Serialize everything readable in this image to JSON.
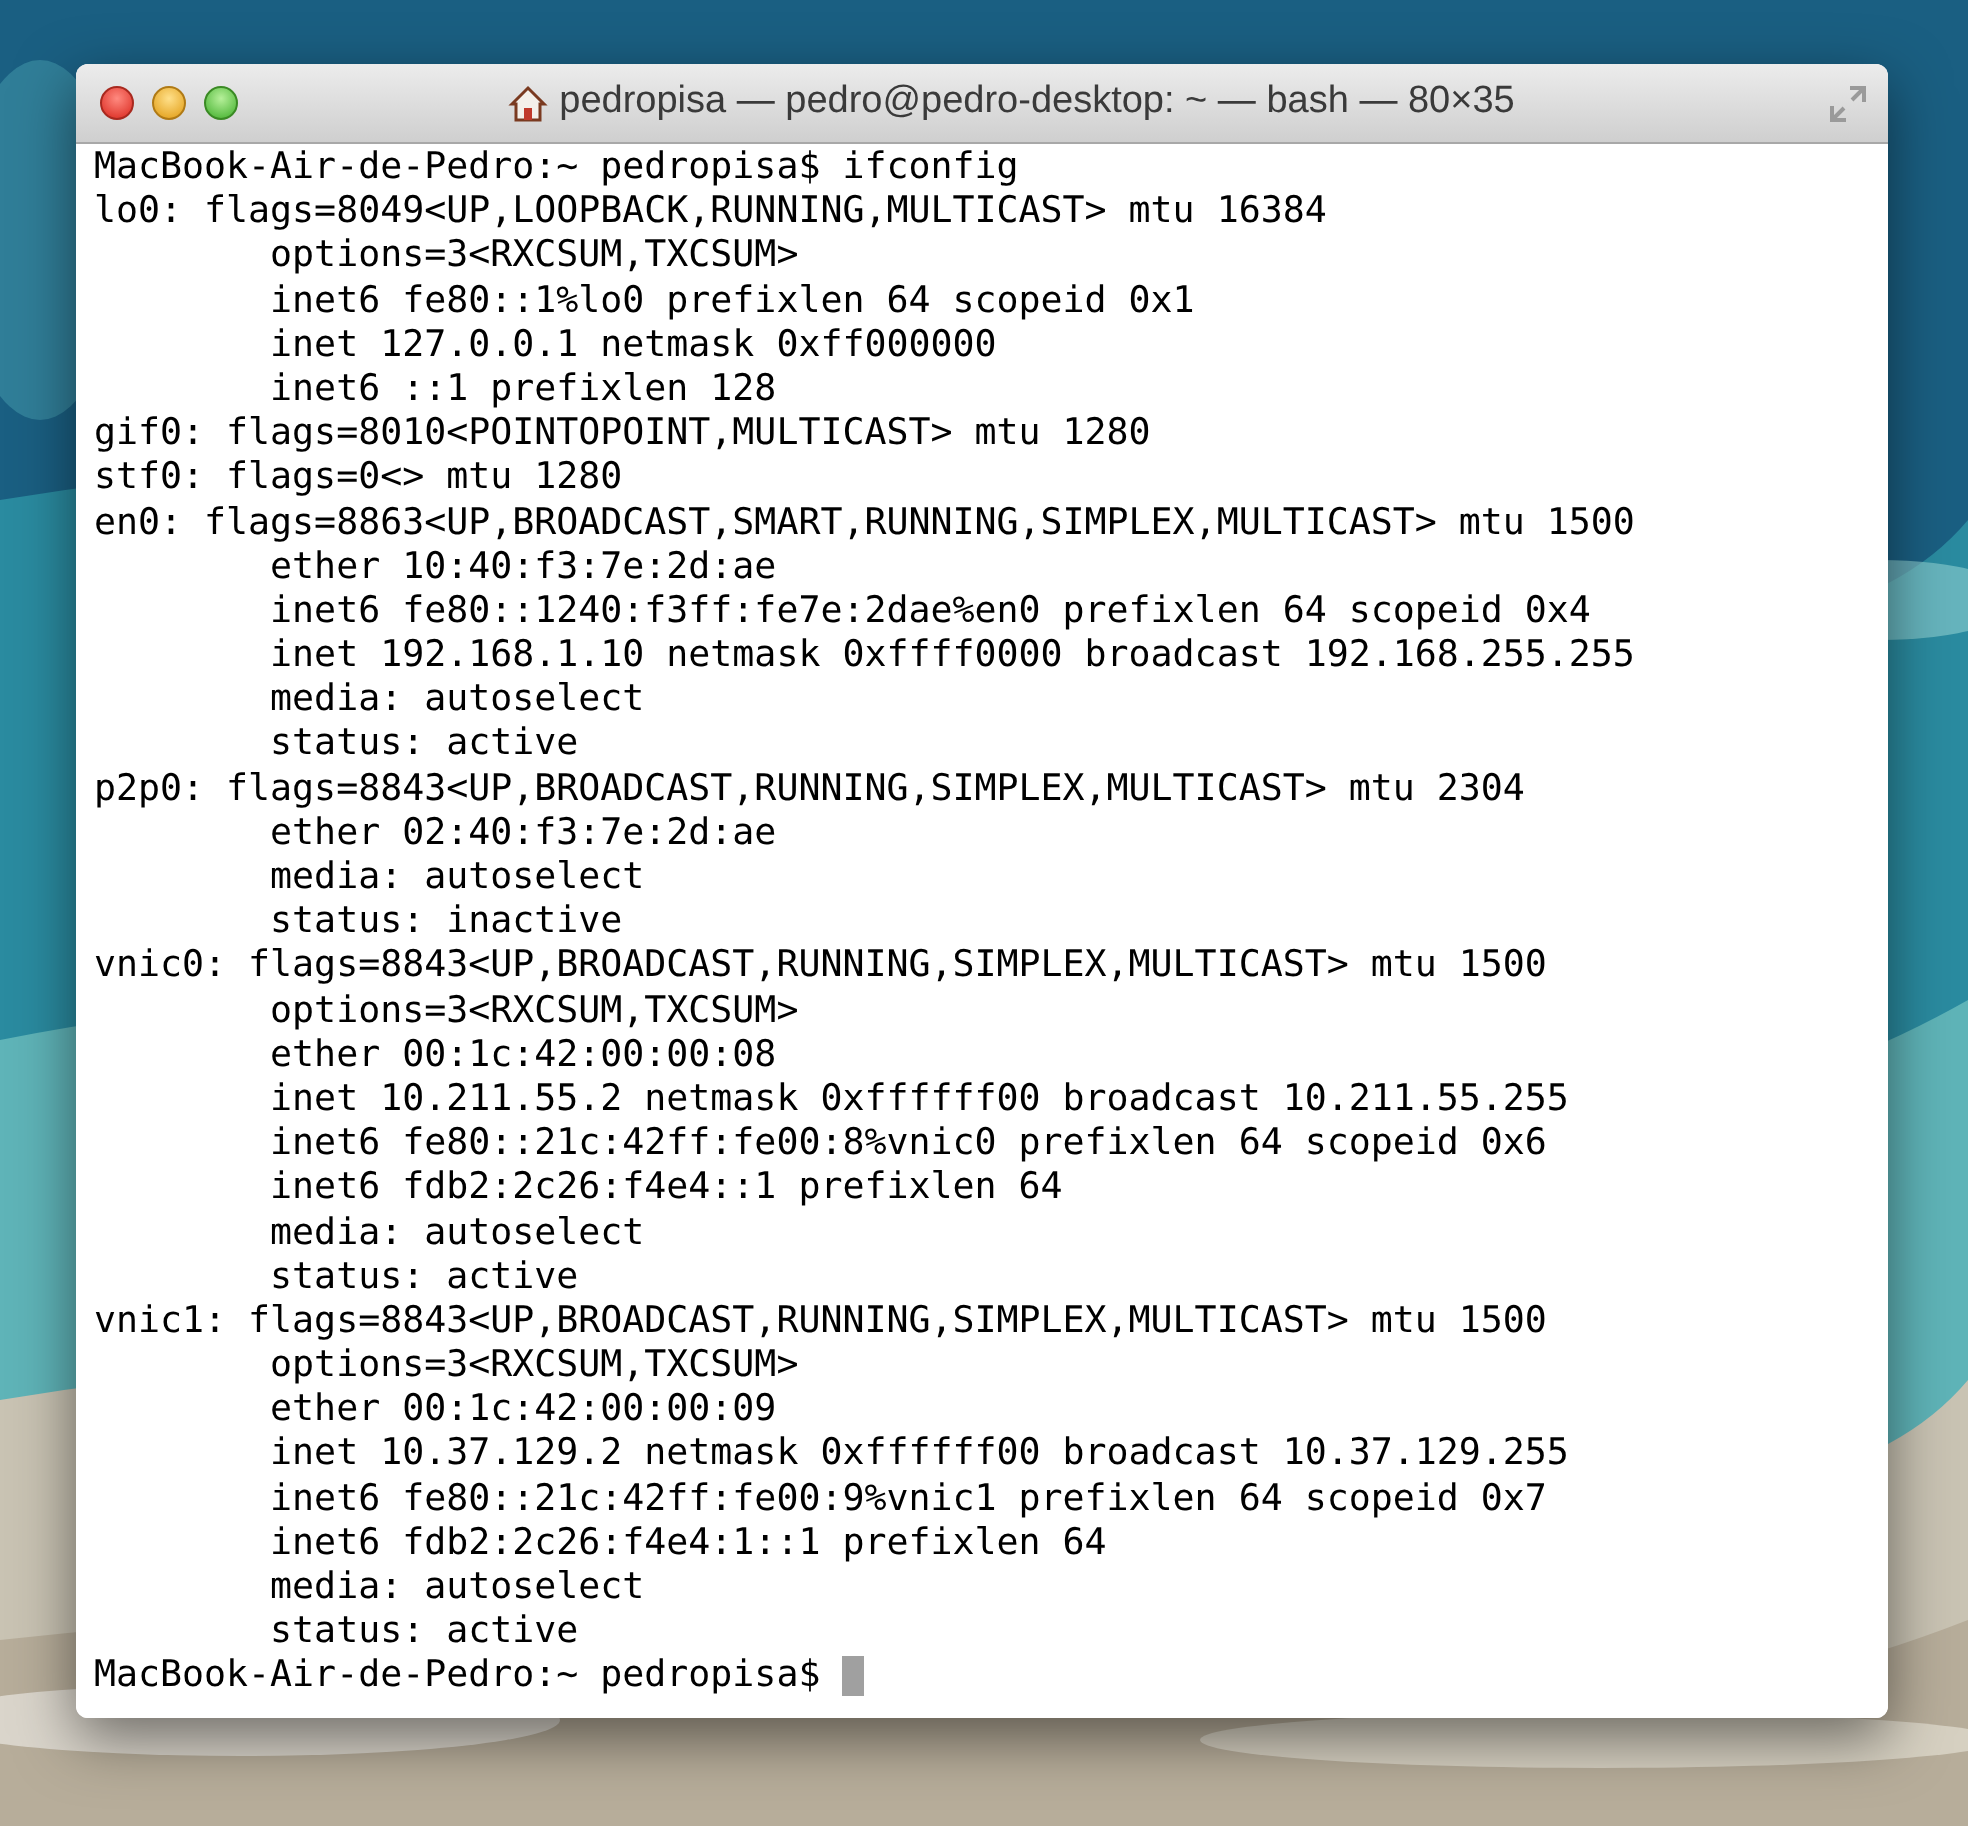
{
  "window": {
    "title": "pedropisa — pedro@pedro-desktop: ~ — bash — 80×35"
  },
  "terminal": {
    "cursor": true,
    "lines": [
      "MacBook-Air-de-Pedro:~ pedropisa$ ifconfig",
      "lo0: flags=8049<UP,LOOPBACK,RUNNING,MULTICAST> mtu 16384",
      "        options=3<RXCSUM,TXCSUM>",
      "        inet6 fe80::1%lo0 prefixlen 64 scopeid 0x1",
      "        inet 127.0.0.1 netmask 0xff000000",
      "        inet6 ::1 prefixlen 128",
      "gif0: flags=8010<POINTOPOINT,MULTICAST> mtu 1280",
      "stf0: flags=0<> mtu 1280",
      "en0: flags=8863<UP,BROADCAST,SMART,RUNNING,SIMPLEX,MULTICAST> mtu 1500",
      "        ether 10:40:f3:7e:2d:ae",
      "        inet6 fe80::1240:f3ff:fe7e:2dae%en0 prefixlen 64 scopeid 0x4",
      "        inet 192.168.1.10 netmask 0xffff0000 broadcast 192.168.255.255",
      "        media: autoselect",
      "        status: active",
      "p2p0: flags=8843<UP,BROADCAST,RUNNING,SIMPLEX,MULTICAST> mtu 2304",
      "        ether 02:40:f3:7e:2d:ae",
      "        media: autoselect",
      "        status: inactive",
      "vnic0: flags=8843<UP,BROADCAST,RUNNING,SIMPLEX,MULTICAST> mtu 1500",
      "        options=3<RXCSUM,TXCSUM>",
      "        ether 00:1c:42:00:00:08",
      "        inet 10.211.55.2 netmask 0xffffff00 broadcast 10.211.55.255",
      "        inet6 fe80::21c:42ff:fe00:8%vnic0 prefixlen 64 scopeid 0x6",
      "        inet6 fdb2:2c26:f4e4::1 prefixlen 64",
      "        media: autoselect",
      "        status: active",
      "vnic1: flags=8843<UP,BROADCAST,RUNNING,SIMPLEX,MULTICAST> mtu 1500",
      "        options=3<RXCSUM,TXCSUM>",
      "        ether 00:1c:42:00:00:09",
      "        inet 10.37.129.2 netmask 0xffffff00 broadcast 10.37.129.255",
      "        inet6 fe80::21c:42ff:fe00:9%vnic1 prefixlen 64 scopeid 0x7",
      "        inet6 fdb2:2c26:f4e4:1::1 prefixlen 64",
      "        media: autoselect",
      "        status: active",
      "MacBook-Air-de-Pedro:~ pedropisa$ "
    ]
  }
}
